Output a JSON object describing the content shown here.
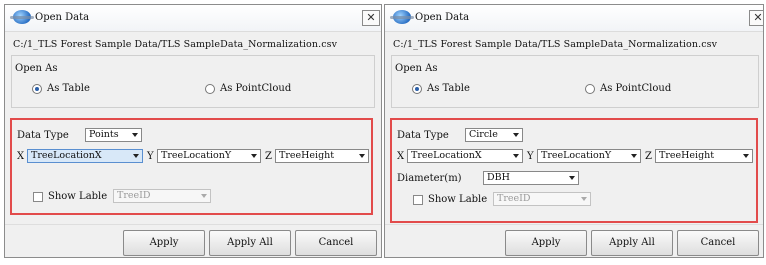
{
  "dialogs": [
    {
      "title": "Open Data",
      "close_glyph": "✕",
      "file_path": "C:/1_TLS Forest Sample Data/TLS SampleData_Normalization.csv",
      "open_as_label": "Open As",
      "radio_table": "As Table",
      "radio_pointcloud": "As PointCloud",
      "data_type_label": "Data Type",
      "data_type_value": "Points",
      "x_label": "X",
      "x_value": "TreeLocationX",
      "y_label": "Y",
      "y_value": "TreeLocationY",
      "z_label": "Z",
      "z_value": "TreeHeight",
      "show_label": "Show Lable",
      "label_field_value": "TreeID",
      "buttons": [
        "Apply",
        "Apply All",
        "Cancel"
      ]
    },
    {
      "title": "Open Data",
      "close_glyph": "✕",
      "file_path": "C:/1_TLS Forest Sample Data/TLS SampleData_Normalization.csv",
      "open_as_label": "Open As",
      "radio_table": "As Table",
      "radio_pointcloud": "As PointCloud",
      "data_type_label": "Data Type",
      "data_type_value": "Circle",
      "x_label": "X",
      "x_value": "TreeLocationX",
      "y_label": "Y",
      "y_value": "TreeLocationY",
      "z_label": "Z",
      "z_value": "TreeHeight",
      "diameter_label": "Diameter(m)",
      "diameter_value": "DBH",
      "show_label": "Show Lable",
      "label_field_value": "TreeID",
      "buttons": [
        "Apply",
        "Apply All",
        "Cancel"
      ]
    }
  ],
  "colors": {
    "highlight_border": "#e24b4b",
    "accent": "#2b5fa8"
  },
  "icons": {
    "title": "globe-app-icon",
    "close": "close-icon",
    "dropdown": "chevron-down-icon"
  }
}
